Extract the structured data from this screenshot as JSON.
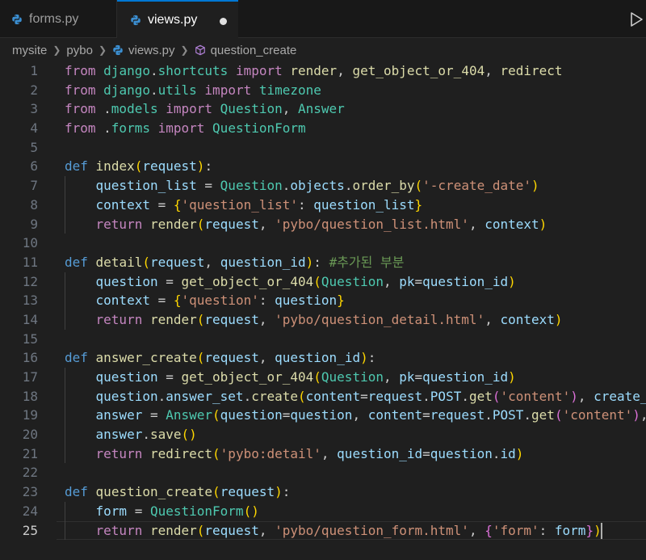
{
  "tabs": [
    {
      "label": "forms.py",
      "active": false
    },
    {
      "label": "views.py",
      "active": true,
      "modified": true
    }
  ],
  "breadcrumb": {
    "items": [
      "mysite",
      "pybo",
      "views.py",
      "question_create"
    ]
  },
  "editor": {
    "active_line": 25,
    "lines": [
      {
        "n": "1",
        "t": [
          [
            "kw",
            "from"
          ],
          [
            "pl",
            " "
          ],
          [
            "cls",
            "django"
          ],
          [
            "pl",
            "."
          ],
          [
            "cls",
            "shortcuts"
          ],
          [
            "pl",
            " "
          ],
          [
            "kw",
            "import"
          ],
          [
            "pl",
            " "
          ],
          [
            "fn",
            "render"
          ],
          [
            "pl",
            ", "
          ],
          [
            "fn",
            "get_object_or_404"
          ],
          [
            "pl",
            ", "
          ],
          [
            "fn",
            "redirect"
          ]
        ]
      },
      {
        "n": "2",
        "t": [
          [
            "kw",
            "from"
          ],
          [
            "pl",
            " "
          ],
          [
            "cls",
            "django"
          ],
          [
            "pl",
            "."
          ],
          [
            "cls",
            "utils"
          ],
          [
            "pl",
            " "
          ],
          [
            "kw",
            "import"
          ],
          [
            "pl",
            " "
          ],
          [
            "cls",
            "timezone"
          ]
        ]
      },
      {
        "n": "3",
        "t": [
          [
            "kw",
            "from"
          ],
          [
            "pl",
            " ."
          ],
          [
            "cls",
            "models"
          ],
          [
            "pl",
            " "
          ],
          [
            "kw",
            "import"
          ],
          [
            "pl",
            " "
          ],
          [
            "cls",
            "Question"
          ],
          [
            "pl",
            ", "
          ],
          [
            "cls",
            "Answer"
          ]
        ]
      },
      {
        "n": "4",
        "t": [
          [
            "kw",
            "from"
          ],
          [
            "pl",
            " ."
          ],
          [
            "cls",
            "forms"
          ],
          [
            "pl",
            " "
          ],
          [
            "kw",
            "import"
          ],
          [
            "pl",
            " "
          ],
          [
            "cls",
            "QuestionForm"
          ]
        ]
      },
      {
        "n": "5",
        "t": []
      },
      {
        "n": "6",
        "t": [
          [
            "def",
            "def"
          ],
          [
            "pl",
            " "
          ],
          [
            "fn",
            "index"
          ],
          [
            "p1",
            "("
          ],
          [
            "var",
            "request"
          ],
          [
            "p1",
            ")"
          ],
          [
            "pl",
            ":"
          ]
        ]
      },
      {
        "n": "7",
        "g": true,
        "t": [
          [
            "pl",
            "    "
          ],
          [
            "var",
            "question_list"
          ],
          [
            "pl",
            " = "
          ],
          [
            "cls",
            "Question"
          ],
          [
            "pl",
            "."
          ],
          [
            "var",
            "objects"
          ],
          [
            "pl",
            "."
          ],
          [
            "fn",
            "order_by"
          ],
          [
            "p1",
            "("
          ],
          [
            "str",
            "'-create_date'"
          ],
          [
            "p1",
            ")"
          ]
        ]
      },
      {
        "n": "8",
        "g": true,
        "t": [
          [
            "pl",
            "    "
          ],
          [
            "var",
            "context"
          ],
          [
            "pl",
            " = "
          ],
          [
            "p1",
            "{"
          ],
          [
            "str",
            "'question_list'"
          ],
          [
            "pl",
            ": "
          ],
          [
            "var",
            "question_list"
          ],
          [
            "p1",
            "}"
          ]
        ]
      },
      {
        "n": "9",
        "g": true,
        "t": [
          [
            "pl",
            "    "
          ],
          [
            "kw",
            "return"
          ],
          [
            "pl",
            " "
          ],
          [
            "fn",
            "render"
          ],
          [
            "p1",
            "("
          ],
          [
            "var",
            "request"
          ],
          [
            "pl",
            ", "
          ],
          [
            "str",
            "'pybo/question_list.html'"
          ],
          [
            "pl",
            ", "
          ],
          [
            "var",
            "context"
          ],
          [
            "p1",
            ")"
          ]
        ]
      },
      {
        "n": "10",
        "t": []
      },
      {
        "n": "11",
        "t": [
          [
            "def",
            "def"
          ],
          [
            "pl",
            " "
          ],
          [
            "fn",
            "detail"
          ],
          [
            "p1",
            "("
          ],
          [
            "var",
            "request"
          ],
          [
            "pl",
            ", "
          ],
          [
            "var",
            "question_id"
          ],
          [
            "p1",
            ")"
          ],
          [
            "pl",
            ": "
          ],
          [
            "cmt",
            "#추가된 부분"
          ]
        ]
      },
      {
        "n": "12",
        "g": true,
        "t": [
          [
            "pl",
            "    "
          ],
          [
            "var",
            "question"
          ],
          [
            "pl",
            " = "
          ],
          [
            "fn",
            "get_object_or_404"
          ],
          [
            "p1",
            "("
          ],
          [
            "cls",
            "Question"
          ],
          [
            "pl",
            ", "
          ],
          [
            "var",
            "pk"
          ],
          [
            "pl",
            "="
          ],
          [
            "var",
            "question_id"
          ],
          [
            "p1",
            ")"
          ]
        ]
      },
      {
        "n": "13",
        "g": true,
        "t": [
          [
            "pl",
            "    "
          ],
          [
            "var",
            "context"
          ],
          [
            "pl",
            " = "
          ],
          [
            "p1",
            "{"
          ],
          [
            "str",
            "'question'"
          ],
          [
            "pl",
            ": "
          ],
          [
            "var",
            "question"
          ],
          [
            "p1",
            "}"
          ]
        ]
      },
      {
        "n": "14",
        "g": true,
        "t": [
          [
            "pl",
            "    "
          ],
          [
            "kw",
            "return"
          ],
          [
            "pl",
            " "
          ],
          [
            "fn",
            "render"
          ],
          [
            "p1",
            "("
          ],
          [
            "var",
            "request"
          ],
          [
            "pl",
            ", "
          ],
          [
            "str",
            "'pybo/question_detail.html'"
          ],
          [
            "pl",
            ", "
          ],
          [
            "var",
            "context"
          ],
          [
            "p1",
            ")"
          ]
        ]
      },
      {
        "n": "15",
        "t": []
      },
      {
        "n": "16",
        "t": [
          [
            "def",
            "def"
          ],
          [
            "pl",
            " "
          ],
          [
            "fn",
            "answer_create"
          ],
          [
            "p1",
            "("
          ],
          [
            "var",
            "request"
          ],
          [
            "pl",
            ", "
          ],
          [
            "var",
            "question_id"
          ],
          [
            "p1",
            ")"
          ],
          [
            "pl",
            ":"
          ]
        ]
      },
      {
        "n": "17",
        "g": true,
        "t": [
          [
            "pl",
            "    "
          ],
          [
            "var",
            "question"
          ],
          [
            "pl",
            " = "
          ],
          [
            "fn",
            "get_object_or_404"
          ],
          [
            "p1",
            "("
          ],
          [
            "cls",
            "Question"
          ],
          [
            "pl",
            ", "
          ],
          [
            "var",
            "pk"
          ],
          [
            "pl",
            "="
          ],
          [
            "var",
            "question_id"
          ],
          [
            "p1",
            ")"
          ]
        ]
      },
      {
        "n": "18",
        "g": true,
        "t": [
          [
            "pl",
            "    "
          ],
          [
            "var",
            "question"
          ],
          [
            "pl",
            "."
          ],
          [
            "var",
            "answer_set"
          ],
          [
            "pl",
            "."
          ],
          [
            "fn",
            "create"
          ],
          [
            "p1",
            "("
          ],
          [
            "var",
            "content"
          ],
          [
            "pl",
            "="
          ],
          [
            "var",
            "request"
          ],
          [
            "pl",
            "."
          ],
          [
            "var",
            "POST"
          ],
          [
            "pl",
            "."
          ],
          [
            "fn",
            "get"
          ],
          [
            "p2",
            "("
          ],
          [
            "str",
            "'content'"
          ],
          [
            "p2",
            ")"
          ],
          [
            "pl",
            ", "
          ],
          [
            "var",
            "create_"
          ]
        ]
      },
      {
        "n": "19",
        "g": true,
        "t": [
          [
            "pl",
            "    "
          ],
          [
            "var",
            "answer"
          ],
          [
            "pl",
            " = "
          ],
          [
            "cls",
            "Answer"
          ],
          [
            "p1",
            "("
          ],
          [
            "var",
            "question"
          ],
          [
            "pl",
            "="
          ],
          [
            "var",
            "question"
          ],
          [
            "pl",
            ", "
          ],
          [
            "var",
            "content"
          ],
          [
            "pl",
            "="
          ],
          [
            "var",
            "request"
          ],
          [
            "pl",
            "."
          ],
          [
            "var",
            "POST"
          ],
          [
            "pl",
            "."
          ],
          [
            "fn",
            "get"
          ],
          [
            "p2",
            "("
          ],
          [
            "str",
            "'content'"
          ],
          [
            "p2",
            ")"
          ],
          [
            "pl",
            ","
          ]
        ]
      },
      {
        "n": "20",
        "g": true,
        "t": [
          [
            "pl",
            "    "
          ],
          [
            "var",
            "answer"
          ],
          [
            "pl",
            "."
          ],
          [
            "fn",
            "save"
          ],
          [
            "p1",
            "()"
          ]
        ]
      },
      {
        "n": "21",
        "g": true,
        "t": [
          [
            "pl",
            "    "
          ],
          [
            "kw",
            "return"
          ],
          [
            "pl",
            " "
          ],
          [
            "fn",
            "redirect"
          ],
          [
            "p1",
            "("
          ],
          [
            "str",
            "'pybo:detail'"
          ],
          [
            "pl",
            ", "
          ],
          [
            "var",
            "question_id"
          ],
          [
            "pl",
            "="
          ],
          [
            "var",
            "question"
          ],
          [
            "pl",
            "."
          ],
          [
            "var",
            "id"
          ],
          [
            "p1",
            ")"
          ]
        ]
      },
      {
        "n": "22",
        "t": []
      },
      {
        "n": "23",
        "t": [
          [
            "def",
            "def"
          ],
          [
            "pl",
            " "
          ],
          [
            "fn",
            "question_create"
          ],
          [
            "p1",
            "("
          ],
          [
            "var",
            "request"
          ],
          [
            "p1",
            ")"
          ],
          [
            "pl",
            ":"
          ]
        ]
      },
      {
        "n": "24",
        "g": true,
        "t": [
          [
            "pl",
            "    "
          ],
          [
            "var",
            "form"
          ],
          [
            "pl",
            " = "
          ],
          [
            "cls",
            "QuestionForm"
          ],
          [
            "p1",
            "()"
          ]
        ]
      },
      {
        "n": "25",
        "g": true,
        "t": [
          [
            "pl",
            "    "
          ],
          [
            "kw",
            "return"
          ],
          [
            "pl",
            " "
          ],
          [
            "fn",
            "render"
          ],
          [
            "p1",
            "("
          ],
          [
            "var",
            "request"
          ],
          [
            "pl",
            ", "
          ],
          [
            "str",
            "'pybo/question_form.html'"
          ],
          [
            "pl",
            ", "
          ],
          [
            "p2",
            "{"
          ],
          [
            "str",
            "'form'"
          ],
          [
            "pl",
            ": "
          ],
          [
            "var",
            "form"
          ],
          [
            "p2",
            "}"
          ],
          [
            "p1",
            ")"
          ]
        ]
      }
    ]
  }
}
